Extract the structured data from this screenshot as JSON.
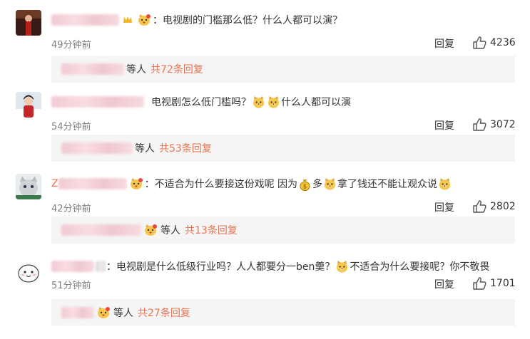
{
  "comments": [
    {
      "text": "电视剧的门槛那么低？什么人都可以演？",
      "time": "49分钟前",
      "reply_label": "回复",
      "likes": "4236",
      "replies_who": "等人",
      "replies_count": "共72条回复"
    },
    {
      "text": "电视剧怎么低门槛吗？",
      "text_after": "什么人都可以演",
      "time": "54分钟前",
      "reply_label": "回复",
      "likes": "3072",
      "replies_who": "等人",
      "replies_count": "共53条回复"
    },
    {
      "nick_visible": "Z",
      "text": "不适合为什么要接这份戏呢 因为",
      "text_mid": "多",
      "text_after": "拿了钱还不能让观众说",
      "time": "42分钟前",
      "reply_label": "回复",
      "likes": "2802",
      "replies_who": "等人",
      "replies_count": "共13条回复"
    },
    {
      "text": "电视剧是什么低级行业吗？人人都要分一ben羹？",
      "text_after": "不适合为什么要接呢？你不敬畏",
      "time": "51分钟前",
      "reply_label": "回复",
      "likes": "1701",
      "replies_who": "等人",
      "replies_count": "共27条回复"
    }
  ],
  "colors": {
    "link": "#eb7350",
    "meta": "#808080",
    "reply_bg": "#f5f5f5"
  },
  "icons": [
    "thumbs-up-icon",
    "doge-emoji",
    "money-bag-emoji",
    "vip-badge",
    "crown-badge"
  ]
}
